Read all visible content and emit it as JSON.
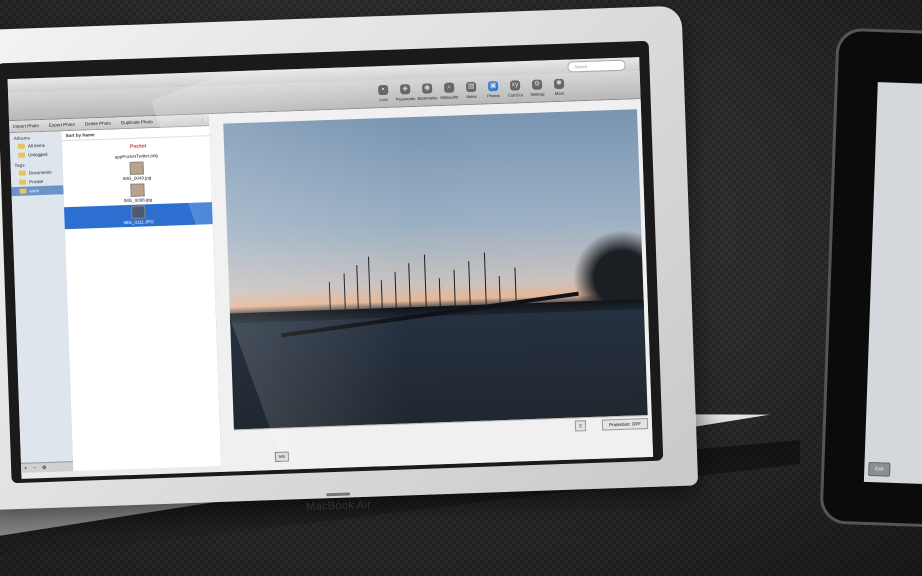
{
  "app": {
    "search_placeholder": "Search",
    "toolbar": [
      {
        "label": "Lock",
        "icon": "lock-icon",
        "glyph": "▪"
      },
      {
        "label": "Passwords",
        "icon": "key-icon",
        "glyph": "◈"
      },
      {
        "label": "Bookmarks",
        "icon": "bookmark-icon",
        "glyph": "◉"
      },
      {
        "label": "Websurfer",
        "icon": "magnifier-icon",
        "glyph": "⌕"
      },
      {
        "label": "Notes",
        "icon": "note-icon",
        "glyph": "▤"
      },
      {
        "label": "Photos",
        "icon": "photo-icon",
        "glyph": "▣"
      },
      {
        "label": "CutnCut",
        "icon": "xy-icon",
        "glyph": "xy"
      },
      {
        "label": "Settings",
        "icon": "gear-icon",
        "glyph": "⚙"
      },
      {
        "label": "More",
        "icon": "more-icon",
        "glyph": "✱"
      }
    ],
    "actions": [
      "Import Photo",
      "Export Photo",
      "Delete Photo",
      "Duplicate Photo"
    ],
    "sidebar": {
      "albums_header": "Albums",
      "albums": [
        "All items",
        "Unlogged"
      ],
      "tags_header": "Tags",
      "tags": [
        "Documents",
        "Private",
        "work"
      ],
      "selected_tag": "work",
      "footer_add": "+",
      "footer_remove": "−",
      "footer_gear": "⚙"
    },
    "filelist": {
      "sort_label": "Sort by Name",
      "files": [
        {
          "name": "appPocketTwitter.png",
          "thumb": "Pocket"
        },
        {
          "name": "IMG_0049.jpg",
          "thumb": ""
        },
        {
          "name": "IMG_0098.jpg",
          "thumb": ""
        },
        {
          "name": "IMG_0111.JPG",
          "thumb": ""
        }
      ],
      "selected_index": 3
    },
    "preview": {
      "protection_status": "Protection: OFF",
      "lock_glyph": "⚿",
      "bottom_button": "Info"
    }
  },
  "device": {
    "laptop_brand": "MacBook Air",
    "ipad_button": "Exit"
  }
}
